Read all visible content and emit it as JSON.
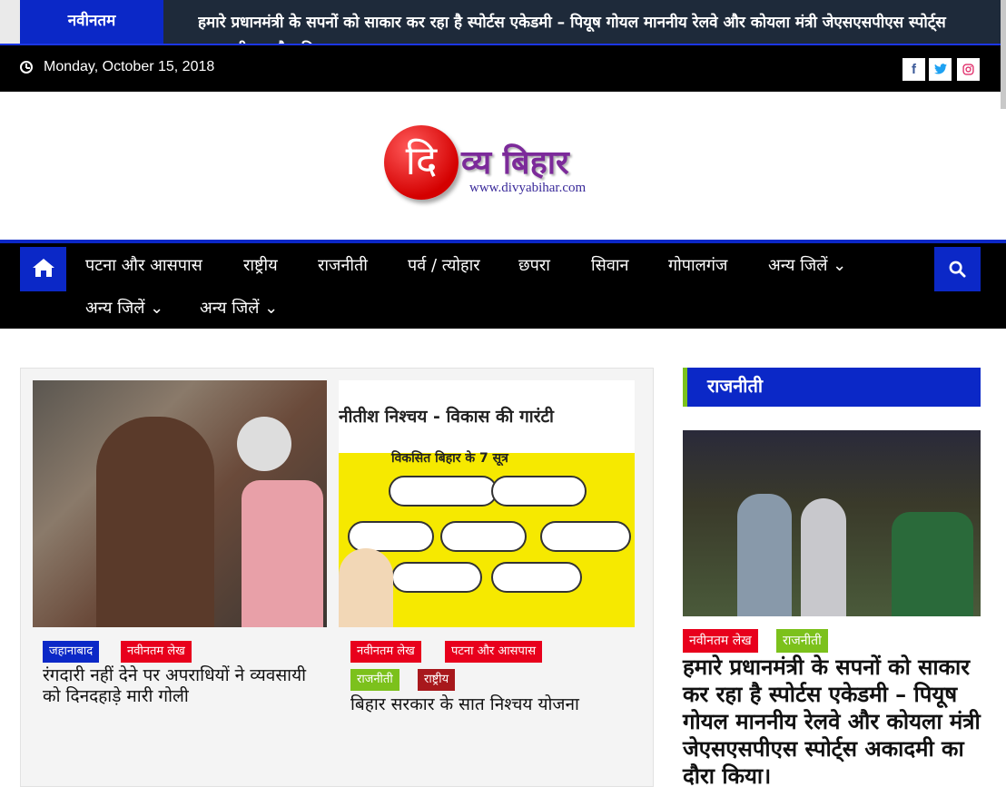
{
  "ticker": {
    "label": "नवीनतम",
    "text": "हमारे प्रधानमंत्री के सपनों को साकार कर रहा है स्पोर्टस एकेडमी – पियूष गोयल माननीय रेलवे और कोयला मंत्री जेएसएसपीएस स्पोर्ट्स अकादमी का दौरा किया।"
  },
  "topbar": {
    "date": "Monday, October 15, 2018",
    "social": {
      "facebook": "f",
      "twitter": "t",
      "instagram": "◎"
    }
  },
  "logo": {
    "initial": "दि",
    "text": "व्य बिहार",
    "url": "www.divyabihar.com"
  },
  "nav": {
    "items": [
      "पटना और आसपास",
      "राष्ट्रीय",
      "राजनीती",
      "पर्व / त्योहार",
      "छपरा",
      "सिवान",
      "गोपालगंज",
      "अन्य जिलें ⌄",
      "अन्य जिलें ⌄",
      "अन्य जिलें ⌄"
    ]
  },
  "posts": [
    {
      "tags": [
        "जहानाबाद",
        "नवीनतम लेख"
      ],
      "title": "रंगदारी नहीं देने पर अपराधियों ने व्यवसायी को दिनदहाड़े मारी गोली"
    },
    {
      "image_title": "नीतीश निश्चय - विकास की गारंटी",
      "image_sub": "विकसित बिहार के 7 सूत्र",
      "tags": [
        "नवीनतम लेख",
        "पटना और आसपास",
        "राजनीती",
        "राष्ट्रीय"
      ],
      "title": "बिहार सरकार के सात निश्चय योजना"
    }
  ],
  "sidebar": {
    "heading": "राजनीती",
    "tags": [
      "नवीनतम लेख",
      "राजनीती"
    ],
    "title": "हमारे प्रधानमंत्री के सपनों को साकार कर रहा है स्पोर्टस एकेडमी – पियूष गोयल माननीय रेलवे और कोयला मंत्री जेएसएसपीएस स्पोर्ट्स अकादमी का दौरा किया।"
  },
  "colors": {
    "brand_blue": "#0b28c7",
    "tag_red": "#e8001c",
    "tag_green": "#7cc11c"
  }
}
